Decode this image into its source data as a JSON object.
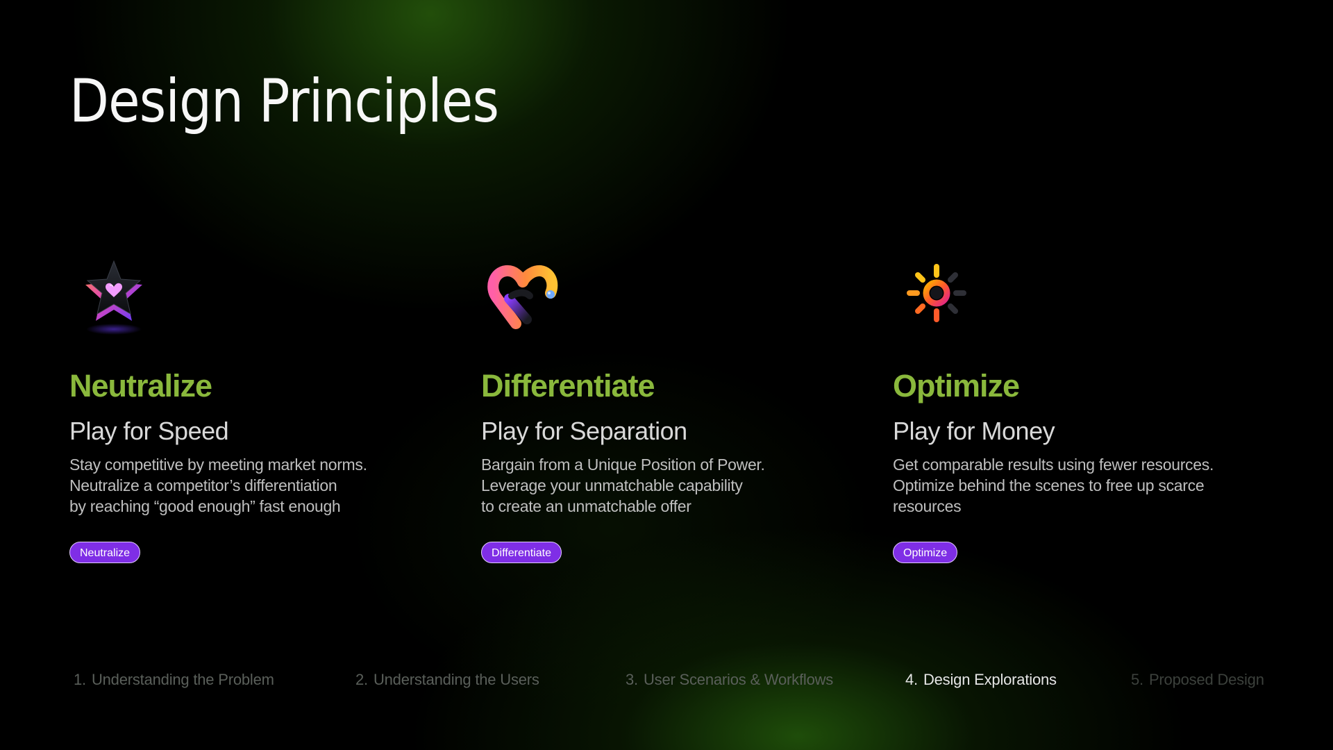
{
  "title": "Design Principles",
  "principles": [
    {
      "icon": "star-heart-icon",
      "heading": "Neutralize",
      "subheading": "Play for Speed",
      "lines": [
        "Stay competitive by meeting market norms.",
        "Neutralize a competitor’s differentiation",
        "by reaching “good enough” fast enough"
      ],
      "tag": "Neutralize"
    },
    {
      "icon": "heart-icon",
      "heading": "Differentiate",
      "subheading": "Play for Separation",
      "lines": [
        "Bargain from a Unique Position of Power.",
        "Leverage your unmatchable capability",
        "to create an unmatchable offer"
      ],
      "tag": "Differentiate"
    },
    {
      "icon": "sun-icon",
      "heading": "Optimize",
      "subheading": "Play for Money",
      "lines": [
        "Get comparable results using fewer resources.",
        "Optimize behind the scenes to free up scarce",
        "resources"
      ],
      "tag": "Optimize"
    }
  ],
  "nav": [
    {
      "num": "1.",
      "label": "Understanding the Problem",
      "state": "inactive"
    },
    {
      "num": "2.",
      "label": "Understanding the Users",
      "state": "inactive"
    },
    {
      "num": "3.",
      "label": "User Scenarios & Workflows",
      "state": "inactive"
    },
    {
      "num": "4.",
      "label": "Design Explorations",
      "state": "active"
    },
    {
      "num": "5.",
      "label": "Proposed Design",
      "state": "inactive"
    }
  ],
  "colors": {
    "heading": "#8ab83c",
    "tag_background": "#7f2ee6",
    "tag_border": "#e3ccff",
    "nav_active": "#e6e6e6",
    "nav_inactive": "#5a5f5a"
  }
}
